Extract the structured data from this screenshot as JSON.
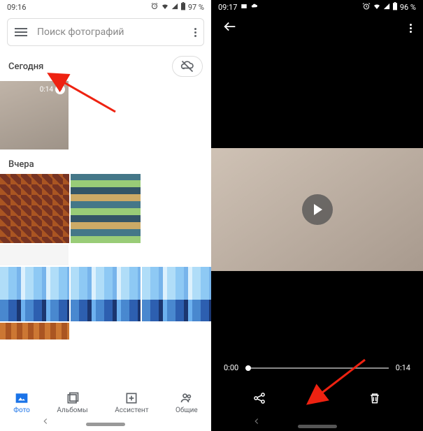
{
  "left": {
    "status": {
      "time": "09:16",
      "battery": "97 %"
    },
    "search": {
      "placeholder": "Поиск фотографий"
    },
    "sections": {
      "today": "Сегодня",
      "yesterday": "Вчера"
    },
    "video_duration": "0:14",
    "nav": {
      "photos": "Фото",
      "albums": "Альбомы",
      "assistant": "Ассистент",
      "shared": "Общие"
    }
  },
  "right": {
    "status": {
      "time": "09:17",
      "battery": "96 %"
    },
    "timeline": {
      "start": "0:00",
      "end": "0:14"
    }
  }
}
